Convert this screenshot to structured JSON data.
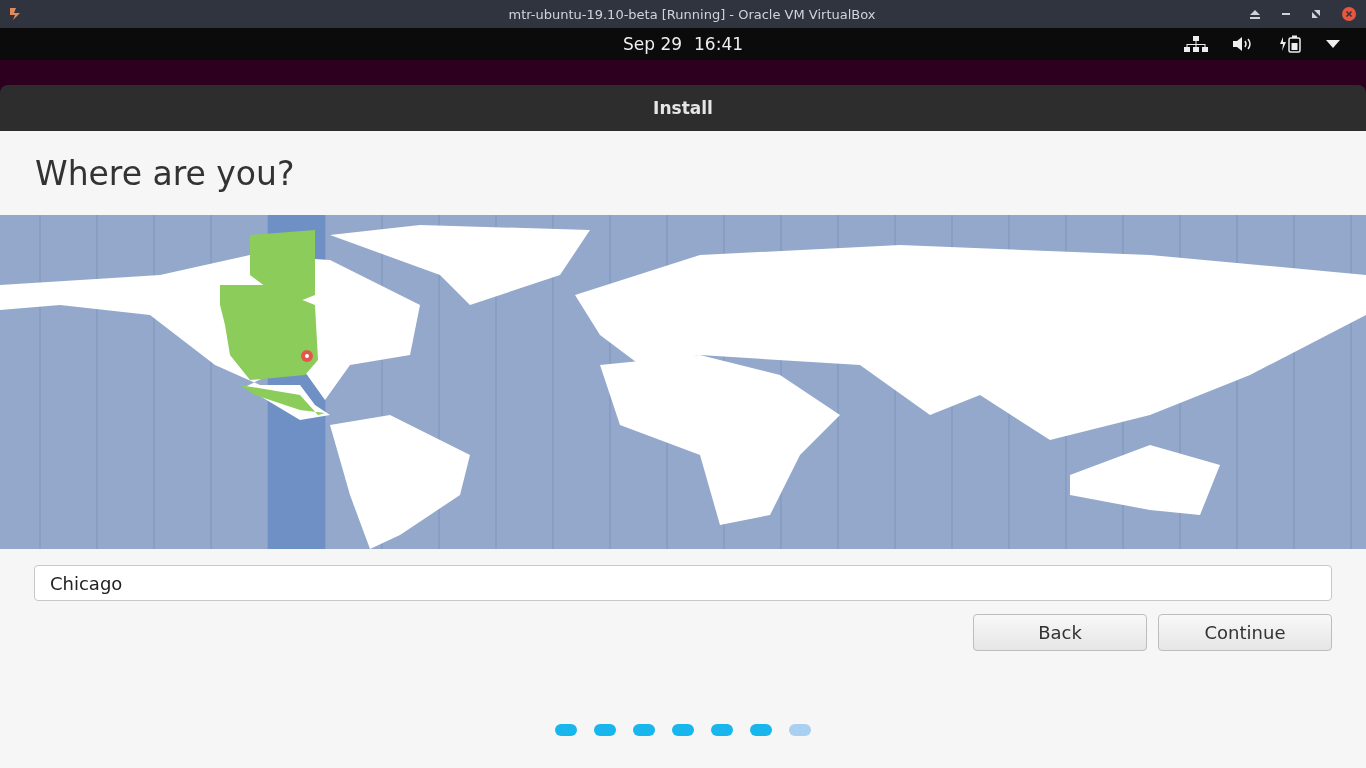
{
  "vm_window": {
    "title": "mtr-ubuntu-19.10-beta [Running] - Oracle VM VirtualBox"
  },
  "top_bar": {
    "date": "Sep 29",
    "time": "16:41"
  },
  "window": {
    "title": "Install"
  },
  "heading": "Where are you?",
  "location": {
    "value": "Chicago"
  },
  "buttons": [
    "Back",
    "Continue"
  ],
  "steps": [
    {
      "done": true
    },
    {
      "done": true
    },
    {
      "done": true
    },
    {
      "done": true
    },
    {
      "done": true
    },
    {
      "done": true
    },
    {
      "done": false
    }
  ]
}
